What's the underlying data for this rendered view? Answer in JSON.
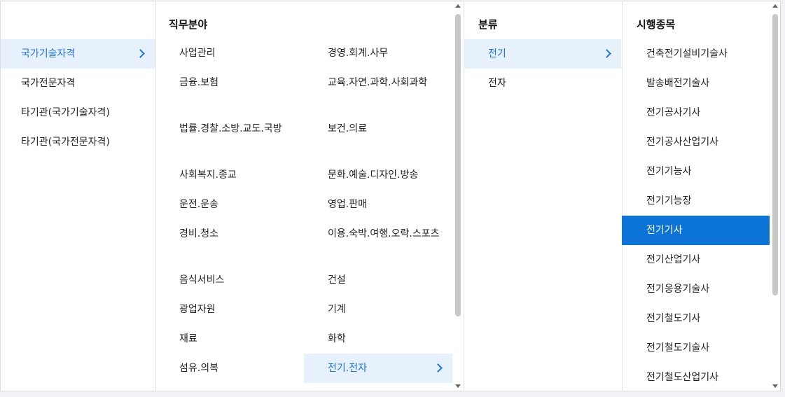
{
  "columns": {
    "type": {
      "items": [
        {
          "label": "국가기술자격"
        },
        {
          "label": "국가전문자격"
        },
        {
          "label": "타기관(국가기술자격)"
        },
        {
          "label": "타기관(국가전문자격)"
        }
      ]
    },
    "field": {
      "header": "직무분야",
      "left": [
        {
          "label": "사업관리"
        },
        {
          "label": "금융.보험"
        },
        {
          "label": "법률.경찰.소방.교도.국방"
        },
        {
          "label": "사회복지.종교"
        },
        {
          "label": "운전.운송"
        },
        {
          "label": "경비.청소"
        },
        {
          "label": "음식서비스"
        },
        {
          "label": "광업자원"
        },
        {
          "label": "재료"
        },
        {
          "label": "섬유.의복"
        }
      ],
      "right": [
        {
          "label": "경영.회계.사무"
        },
        {
          "label": "교육.자연.과학.사회과학"
        },
        {
          "label": "보건.의료"
        },
        {
          "label": "문화.예술.디자인.방송"
        },
        {
          "label": "영업.판매"
        },
        {
          "label": "이용.숙박.여행.오락.스포츠"
        },
        {
          "label": "건설"
        },
        {
          "label": "기계"
        },
        {
          "label": "화학"
        },
        {
          "label": "전기.전자"
        }
      ]
    },
    "classification": {
      "header": "분류",
      "items": [
        {
          "label": "전기"
        },
        {
          "label": "전자"
        }
      ]
    },
    "exam": {
      "header": "시행종목",
      "items": [
        {
          "label": "건축전기설비기술사"
        },
        {
          "label": "발송배전기술사"
        },
        {
          "label": "전기공사기사"
        },
        {
          "label": "전기공사산업기사"
        },
        {
          "label": "전기기능사"
        },
        {
          "label": "전기기능장"
        },
        {
          "label": "전기기사"
        },
        {
          "label": "전기산업기사"
        },
        {
          "label": "전기응용기술사"
        },
        {
          "label": "전기철도기사"
        },
        {
          "label": "전기철도기술사"
        },
        {
          "label": "전기철도산업기사"
        }
      ]
    }
  },
  "colors": {
    "selected_bg": "#e6f1fb",
    "selected_text": "#1a73e8",
    "active_bg": "#0c74d6"
  }
}
